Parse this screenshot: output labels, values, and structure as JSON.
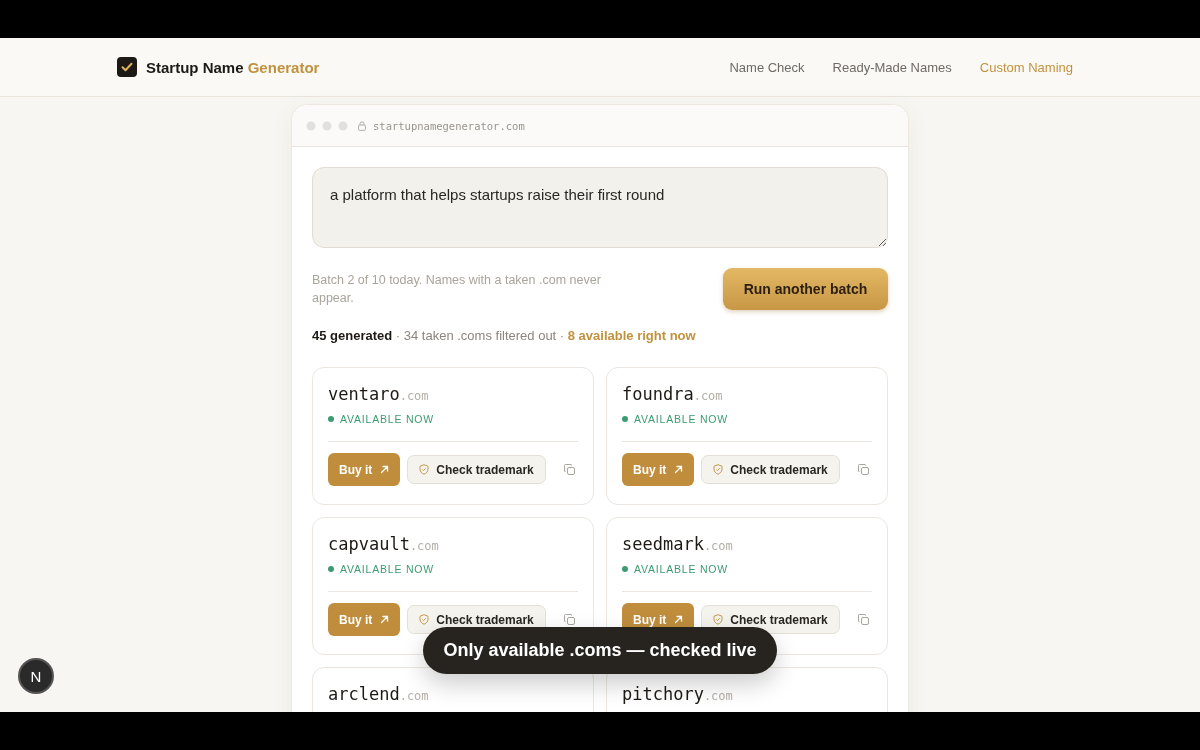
{
  "brand": {
    "name": "Startup Name",
    "accent": "Generator"
  },
  "nav": [
    {
      "label": "Name Check",
      "selected": false
    },
    {
      "label": "Ready-Made Names",
      "selected": false
    },
    {
      "label": "Custom Naming",
      "selected": true
    }
  ],
  "browser": {
    "url": "startupnamegenerator.com"
  },
  "prompt": {
    "value": "a platform that helps startups raise their first round"
  },
  "batch_note": "Batch 2 of 10 today. Names with a taken .com never appear.",
  "run_button": "Run another batch",
  "stats": [
    {
      "kind": "strong",
      "text": "45 generated"
    },
    {
      "kind": "muted",
      "text": " · 34 taken .coms filtered out · "
    },
    {
      "kind": "accent",
      "text": "8 available right now"
    }
  ],
  "results": [
    {
      "name": "ventaro",
      "tld": ".com",
      "status": "AVAILABLE NOW",
      "available": true,
      "buy": "Buy it",
      "trademark": "Check trademark"
    },
    {
      "name": "foundra",
      "tld": ".com",
      "status": "AVAILABLE NOW",
      "available": true,
      "buy": "Buy it",
      "trademark": "Check trademark"
    },
    {
      "name": "capvault",
      "tld": ".com",
      "status": "AVAILABLE NOW",
      "available": true,
      "buy": "Buy it",
      "trademark": "Check trademark"
    },
    {
      "name": "seedmark",
      "tld": ".com",
      "status": "AVAILABLE NOW",
      "available": true,
      "buy": "Buy it",
      "trademark": "Check trademark"
    },
    {
      "name": "arclend",
      "tld": ".com"
    },
    {
      "name": "pitchory",
      "tld": ".com"
    }
  ],
  "toast": "Only available **.coms** — checked live",
  "dev_badge": "N"
}
